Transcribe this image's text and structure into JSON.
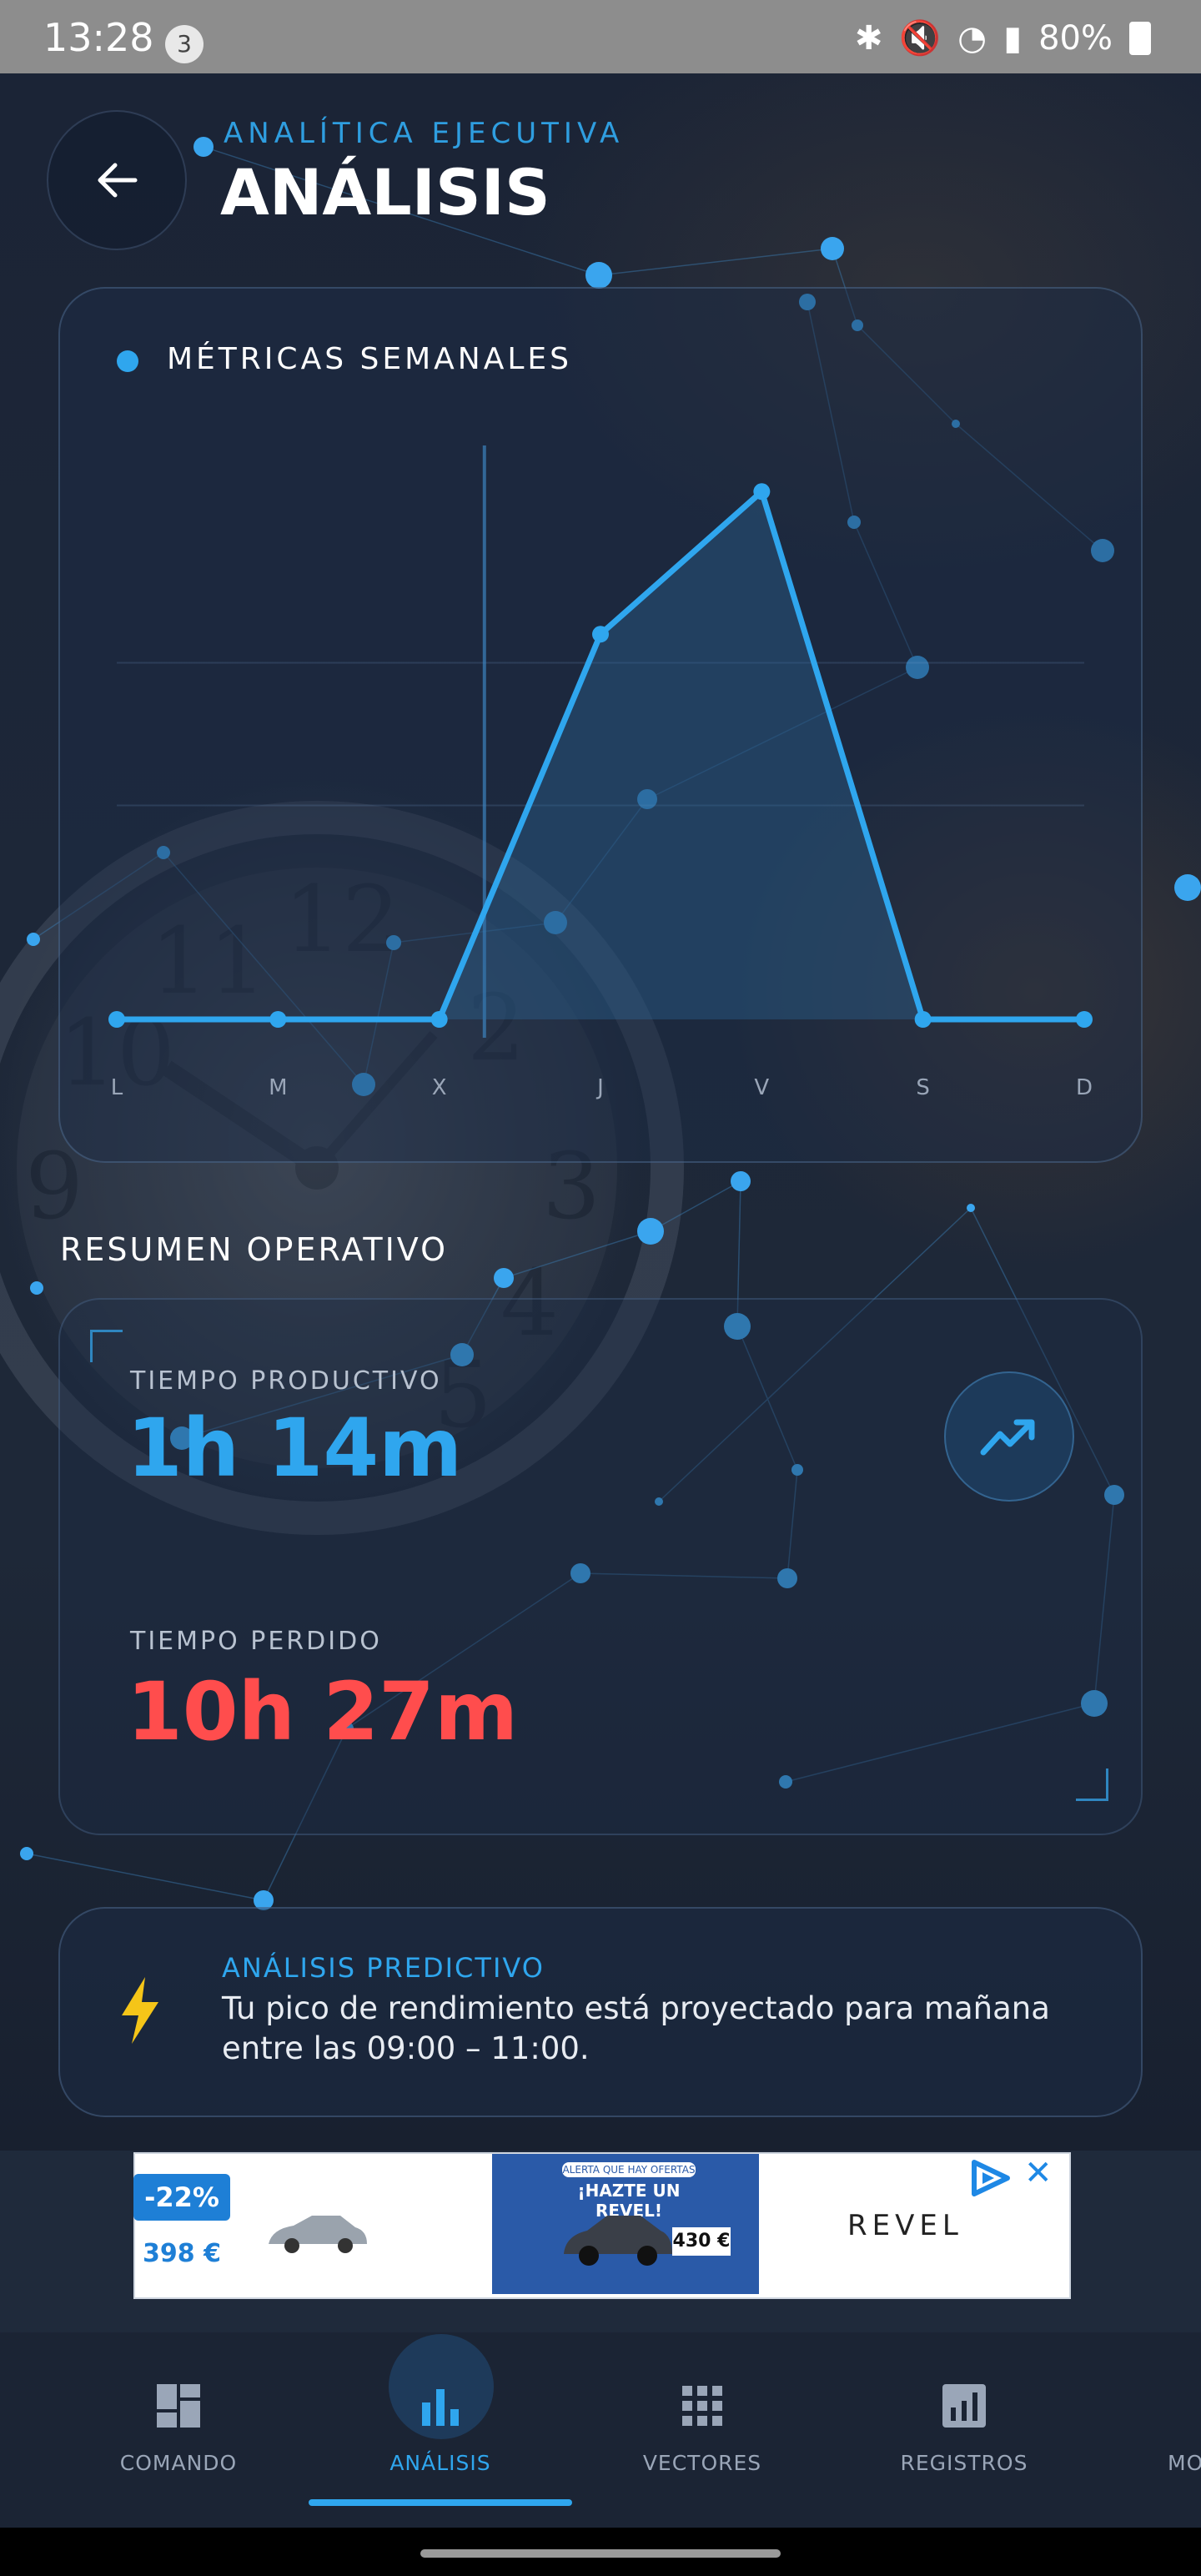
{
  "status_bar": {
    "time": "13:28",
    "notification_count": "3",
    "battery": "80%"
  },
  "header": {
    "subtitle": "ANALÍTICA EJECUTIVA",
    "title": "ANÁLISIS"
  },
  "chart_card": {
    "heading": "MÉTRICAS SEMANALES"
  },
  "chart_data": {
    "type": "area",
    "categories": [
      "L",
      "M",
      "X",
      "J",
      "V",
      "S",
      "D"
    ],
    "values": [
      0,
      0,
      0,
      2.7,
      3.7,
      0,
      0
    ],
    "ylim": [
      0,
      4
    ],
    "grid": true,
    "colors": {
      "line": "#2fa6ee",
      "fill": "#2f6ea0"
    }
  },
  "summary": {
    "title": "RESUMEN OPERATIVO",
    "productive_label": "TIEMPO PRODUCTIVO",
    "productive_value": "1h 14m",
    "lost_label": "TIEMPO PERDIDO",
    "lost_value": "10h 27m",
    "colors": {
      "productive": "#2fa6ee",
      "lost": "#ff4d4d"
    }
  },
  "predictive": {
    "title": "ANÁLISIS PREDICTIVO",
    "text": "Tu pico de rendimiento está proyectado para mañana entre las 09:00 – 11:00."
  },
  "ad": {
    "discount": "-22%",
    "price_left": "398 €",
    "alert": "ALERTA QUE HAY OFERTAS",
    "headline": "¡HAZTE UN REVEL!",
    "price_mid": "430 €",
    "brand": "REVEL"
  },
  "nav": {
    "items": [
      {
        "label": "COMANDO",
        "icon": "dashboard-icon"
      },
      {
        "label": "ANÁLISIS",
        "icon": "bar-chart-icon",
        "active": true
      },
      {
        "label": "VECTORES",
        "icon": "grid-icon"
      },
      {
        "label": "REGISTROS",
        "icon": "report-icon"
      },
      {
        "label": "MO",
        "icon": "more-icon"
      }
    ]
  },
  "colors": {
    "accent": "#2fa6ee",
    "background": "#1a2233"
  }
}
